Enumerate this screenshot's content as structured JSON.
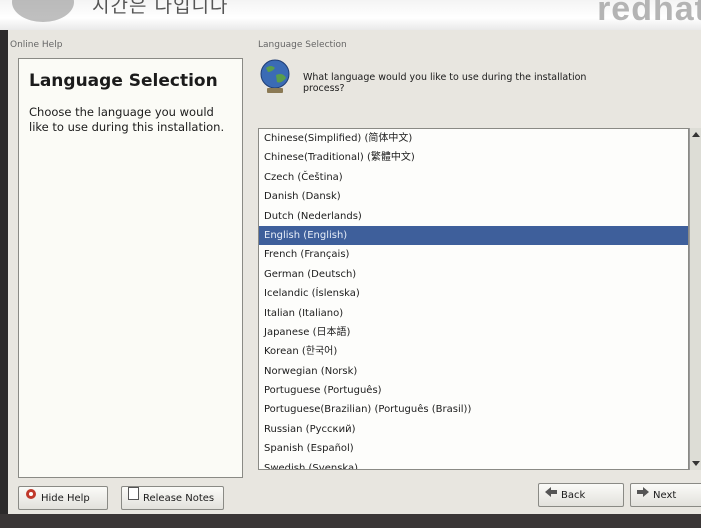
{
  "window": {
    "caption_text": "시간은 다입니다",
    "brand": "redhat"
  },
  "help": {
    "header": "Online Help",
    "title": "Language Selection",
    "body": "Choose the language you would like to use during this installation."
  },
  "section": {
    "header": "Language Selection",
    "question": "What language would you like to use during the installation process?"
  },
  "languages": {
    "items": [
      "Chinese(Simplified) (简体中文)",
      "Chinese(Traditional) (繁體中文)",
      "Czech (Čeština)",
      "Danish (Dansk)",
      "Dutch (Nederlands)",
      "English (English)",
      "French (Français)",
      "German (Deutsch)",
      "Icelandic (Íslenska)",
      "Italian (Italiano)",
      "Japanese (日本語)",
      "Korean (한국어)",
      "Norwegian (Norsk)",
      "Portuguese (Português)",
      "Portuguese(Brazilian) (Português (Brasil))",
      "Russian (Русский)",
      "Spanish (Español)",
      "Swedish (Svenska)"
    ],
    "selected_index": 5
  },
  "buttons": {
    "hide_help": "Hide Help",
    "release_notes": "Release Notes",
    "back": "Back",
    "next": "Next"
  },
  "colors": {
    "selection": "#3e5f9b",
    "panel_bg": "#e8e6e0"
  }
}
